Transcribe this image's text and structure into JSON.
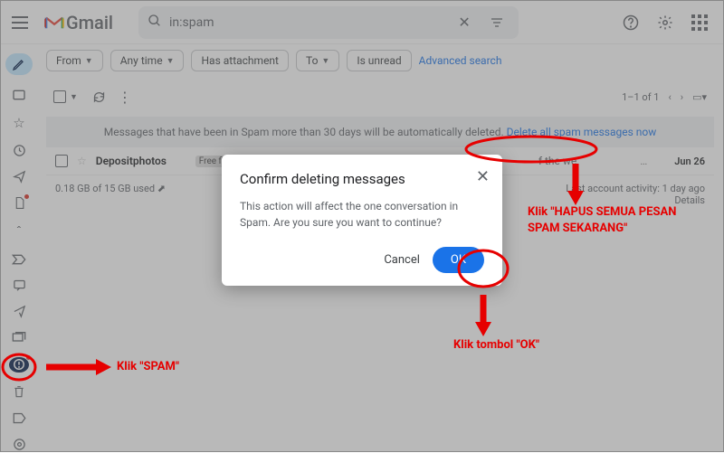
{
  "header": {
    "logo_text": "Gmail",
    "search_value": "in:spam"
  },
  "chips": {
    "from": "From",
    "anytime": "Any time",
    "has_attachment": "Has attachment",
    "to": "To",
    "is_unread": "Is unread",
    "advanced": "Advanced search"
  },
  "toolbar": {
    "count": "1–1 of 1"
  },
  "banner": {
    "text": "Messages that have been in Spam more than 30 days will be automatically deleted.",
    "link": "Delete all spam messages now"
  },
  "rows": [
    {
      "sender": "Depositphotos",
      "badge": "Free files",
      "snippet": "f the we",
      "date": "Jun 26"
    }
  ],
  "footer": {
    "storage": "0.18 GB of 15 GB used",
    "activity": "Last account activity: 1 day ago",
    "details": "Details"
  },
  "modal": {
    "title": "Confirm deleting messages",
    "body": "This action will affect the one conversation in Spam. Are you sure you want to continue?",
    "cancel": "Cancel",
    "ok": "OK"
  },
  "annotations": {
    "spam": "Klik \"SPAM\"",
    "delete_all": "Klik \"HAPUS SEMUA PESAN SPAM SEKARANG\"",
    "ok": "Klik tombol \"OK\""
  }
}
